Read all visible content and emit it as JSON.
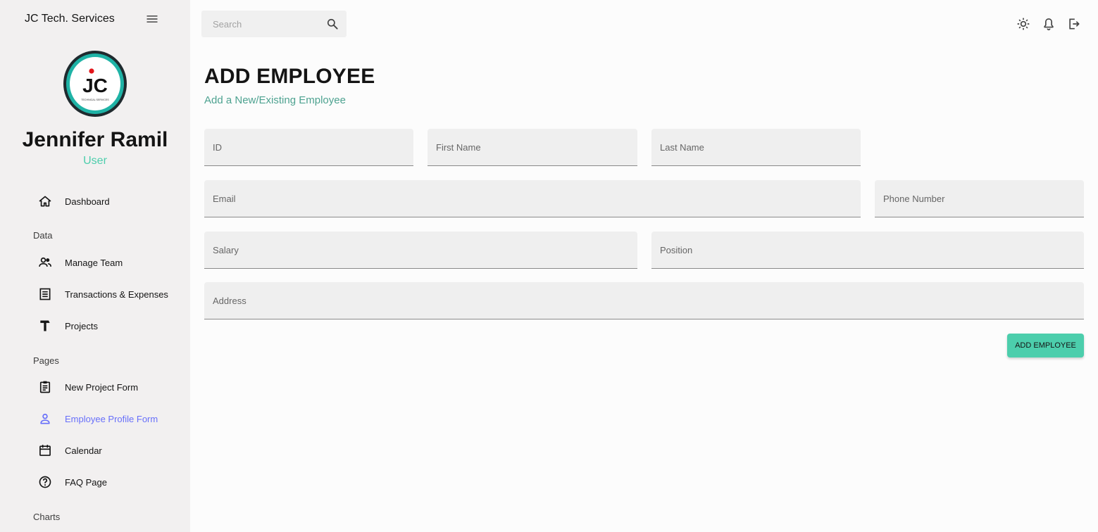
{
  "sidebar": {
    "brand": "JC Tech. Services",
    "user_name": "Jennifer Ramil",
    "user_role": "User",
    "items": [
      {
        "label": "Dashboard"
      },
      {
        "label": "Manage Team"
      },
      {
        "label": "Transactions & Expenses"
      },
      {
        "label": "Projects"
      },
      {
        "label": "New Project Form"
      },
      {
        "label": "Employee Profile Form"
      },
      {
        "label": "Calendar"
      },
      {
        "label": "FAQ Page"
      }
    ],
    "sections": [
      "Data",
      "Pages",
      "Charts"
    ]
  },
  "topbar": {
    "search_placeholder": "Search"
  },
  "header": {
    "title": "ADD EMPLOYEE",
    "subtitle": "Add a New/Existing Employee"
  },
  "form": {
    "id_placeholder": "ID",
    "first_name_placeholder": "First Name",
    "last_name_placeholder": "Last Name",
    "email_placeholder": "Email",
    "phone_placeholder": "Phone Number",
    "salary_placeholder": "Salary",
    "position_placeholder": "Position",
    "address_placeholder": "Address",
    "submit_label": "ADD EMPLOYEE"
  },
  "colors": {
    "accent_green": "#4cceac",
    "active_purple": "#6870fa",
    "subtitle_green": "#4da290",
    "sidebar_bg": "#f2f0f0"
  },
  "logo": {
    "text": "JC",
    "subtext": "TECHNICAL SERVICES"
  }
}
